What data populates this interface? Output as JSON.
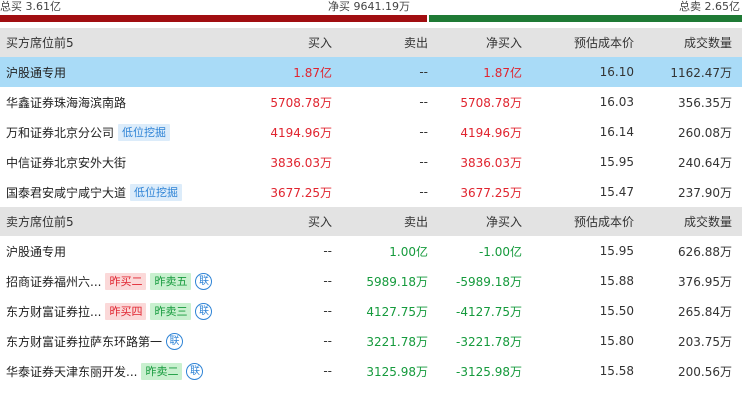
{
  "summary": {
    "total_buy": "总买 3.61亿",
    "net_buy": "净买 9641.19万",
    "total_sell": "总卖 2.65亿",
    "buy_share": 0.575
  },
  "buy_section": {
    "header": [
      "买方席位前5",
      "买入",
      "卖出",
      "净买入",
      "预估成本价",
      "成交数量"
    ],
    "rows": [
      {
        "name": "沪股通专用",
        "tags": [],
        "buy": "1.87亿",
        "sell": "--",
        "net": "1.87亿",
        "cost": "16.10",
        "volume": "1162.47万",
        "highlight": true
      },
      {
        "name": "华鑫证券珠海海滨南路",
        "tags": [],
        "buy": "5708.78万",
        "sell": "--",
        "net": "5708.78万",
        "cost": "16.03",
        "volume": "356.35万"
      },
      {
        "name": "万和证券北京分公司",
        "tags": [
          {
            "text": "低位挖掘",
            "color": "blue"
          }
        ],
        "buy": "4194.96万",
        "sell": "--",
        "net": "4194.96万",
        "cost": "16.14",
        "volume": "260.08万"
      },
      {
        "name": "中信证券北京安外大街",
        "tags": [],
        "buy": "3836.03万",
        "sell": "--",
        "net": "3836.03万",
        "cost": "15.95",
        "volume": "240.64万"
      },
      {
        "name": "国泰君安咸宁咸宁大道",
        "tags": [
          {
            "text": "低位挖掘",
            "color": "blue"
          }
        ],
        "buy": "3677.25万",
        "sell": "--",
        "net": "3677.25万",
        "cost": "15.47",
        "volume": "237.90万"
      }
    ]
  },
  "sell_section": {
    "header": [
      "卖方席位前5",
      "买入",
      "卖出",
      "净买入",
      "预估成本价",
      "成交数量"
    ],
    "rows": [
      {
        "name": "沪股通专用",
        "tags": [],
        "lian": false,
        "buy": "--",
        "sell": "1.00亿",
        "net": "-1.00亿",
        "cost": "15.95",
        "volume": "626.88万"
      },
      {
        "name": "招商证券福州六...",
        "tags": [
          {
            "text": "昨买二",
            "color": "red"
          },
          {
            "text": "昨卖五",
            "color": "green"
          }
        ],
        "lian": true,
        "buy": "--",
        "sell": "5989.18万",
        "net": "-5989.18万",
        "cost": "15.88",
        "volume": "376.95万"
      },
      {
        "name": "东方财富证券拉...",
        "tags": [
          {
            "text": "昨买四",
            "color": "red"
          },
          {
            "text": "昨卖三",
            "color": "green"
          }
        ],
        "lian": true,
        "buy": "--",
        "sell": "4127.75万",
        "net": "-4127.75万",
        "cost": "15.50",
        "volume": "265.84万"
      },
      {
        "name": "东方财富证券拉萨东环路第一",
        "tags": [],
        "lian": true,
        "buy": "--",
        "sell": "3221.78万",
        "net": "-3221.78万",
        "cost": "15.80",
        "volume": "203.75万"
      },
      {
        "name": "华泰证券天津东丽开发...",
        "tags": [
          {
            "text": "昨卖二",
            "color": "green"
          }
        ],
        "lian": true,
        "buy": "--",
        "sell": "3125.98万",
        "net": "-3125.98万",
        "cost": "15.58",
        "volume": "200.56万"
      }
    ]
  },
  "icons": {
    "lian": "联"
  },
  "colors": {
    "buy_bar": "#a10e11",
    "sell_bar": "#1f7a35",
    "up": "#e0242f",
    "down": "#159a3c",
    "highlight": "#a9dbf7"
  }
}
